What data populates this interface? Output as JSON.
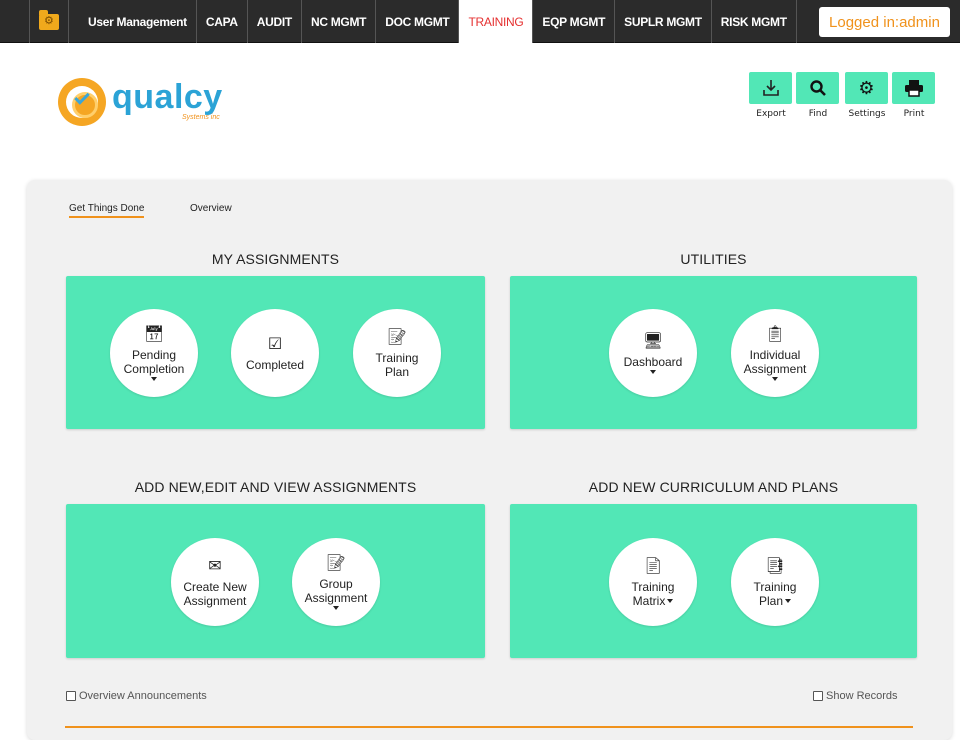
{
  "nav": {
    "items": [
      {
        "label": "User Management"
      },
      {
        "label": "CAPA"
      },
      {
        "label": "AUDIT"
      },
      {
        "label": "NC MGMT"
      },
      {
        "label": "DOC MGMT"
      },
      {
        "label": "TRAINING"
      },
      {
        "label": "EQP MGMT"
      },
      {
        "label": "SUPLR MGMT"
      },
      {
        "label": "RISK MGMT"
      }
    ],
    "active": "TRAINING",
    "login_text": "Logged in:admin"
  },
  "logo": {
    "name": "qualcy",
    "sub": "Systems inc"
  },
  "toolbar": {
    "export_label": "Export",
    "find_label": "Find",
    "settings_label": "Settings",
    "print_label": "Print"
  },
  "tabs": {
    "get_things_done": "Get Things Done",
    "overview": "Overview"
  },
  "sections": {
    "my_assignments": {
      "title": "MY ASSIGNMENTS",
      "pending": {
        "line1": "Pending",
        "line2": "Completion"
      },
      "completed": {
        "line1": "Completed"
      },
      "training_plan": {
        "line1": "Training",
        "line2": "Plan"
      }
    },
    "utilities": {
      "title": "UTILITIES",
      "dashboard": {
        "line1": "Dashboard"
      },
      "individual": {
        "line1": "Individual",
        "line2": "Assignment"
      }
    },
    "add_edit": {
      "title": "ADD NEW,EDIT AND VIEW ASSIGNMENTS",
      "create": {
        "line1": "Create New",
        "line2": "Assignment"
      },
      "group": {
        "line1": "Group",
        "line2": "Assignment"
      }
    },
    "curriculum": {
      "title": "ADD NEW CURRICULUM AND PLANS",
      "matrix": {
        "line1": "Training",
        "line2": "Matrix"
      },
      "plan": {
        "line1": "Training",
        "line2": "Plan"
      }
    }
  },
  "footer": {
    "overview_announcements": "Overview Announcements",
    "show_records": "Show Records"
  },
  "colors": {
    "accent_green": "#52e7b6",
    "accent_orange": "#f0921c",
    "active_red": "#e53030",
    "nav_bg": "#2b2b2b"
  },
  "icons": [
    "folder-gear-icon",
    "download-icon",
    "search-icon",
    "gear-icon",
    "printer-icon",
    "calendar-clock-icon",
    "checkbox-icon",
    "document-edit-icon",
    "monitor-gears-icon",
    "person-document-icon",
    "envelope-edit-icon",
    "matrix-document-icon",
    "stacked-documents-icon"
  ]
}
